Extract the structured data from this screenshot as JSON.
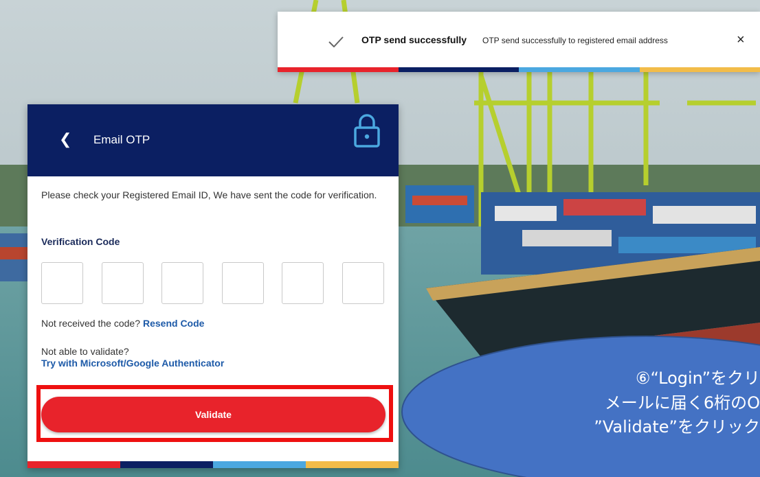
{
  "toast": {
    "icon": "check-icon",
    "title": "OTP send successfully",
    "message": "OTP send successfully to registered email address",
    "close": "×"
  },
  "colors": {
    "navy": "#0b1f62",
    "red": "#e8232b",
    "light_blue": "#4ba8e0",
    "yellow": "#f2bc49",
    "link": "#1d5aa8",
    "highlight": "#ee1010",
    "bubble": "#4472c4"
  },
  "card": {
    "back_icon": "chevron-left-icon",
    "title": "Email OTP",
    "lock_icon": "lock-icon",
    "instructions": "Please check your Registered Email ID, We have sent the code for verification.",
    "verification_label": "Verification Code",
    "otp_digits": [
      "",
      "",
      "",
      "",
      "",
      ""
    ],
    "not_received": "Not received the code?",
    "resend": "Resend Code",
    "not_able": "Not able to validate?",
    "authenticator_link": "Try with Microsoft/Google Authenticator",
    "validate": "Validate"
  },
  "annotation": {
    "line1": "⑥“Login”をクリ",
    "line2": "メールに届く6桁のO",
    "line3": "”Validate”をクリック"
  }
}
